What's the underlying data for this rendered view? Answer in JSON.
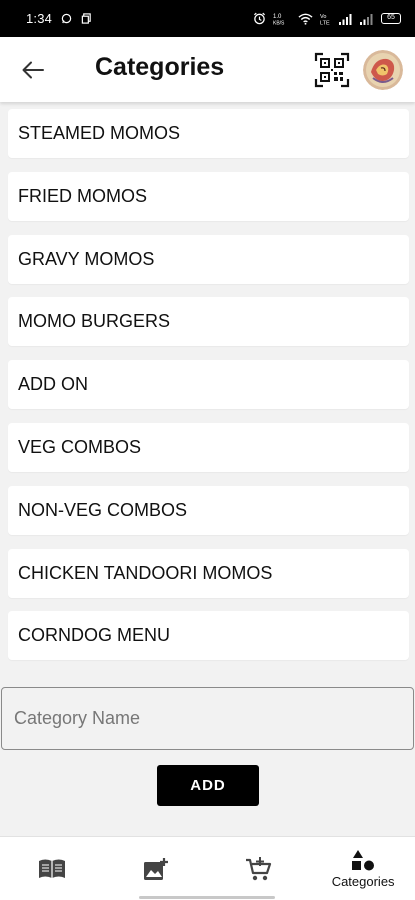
{
  "status_bar": {
    "time": "1:34",
    "battery": "65"
  },
  "header": {
    "title": "Categories"
  },
  "categories": [
    "STEAMED MOMOS",
    "FRIED MOMOS",
    "GRAVY MOMOS",
    "MOMO BURGERS",
    "ADD ON",
    "VEG COMBOS",
    "NON-VEG COMBOS",
    "CHICKEN TANDOORI MOMOS",
    "CORNDOG MENU"
  ],
  "form": {
    "placeholder": "Category Name",
    "value": "",
    "add_label": "ADD"
  },
  "bottom_nav": {
    "items": [
      {
        "icon": "menu-book-icon",
        "label": ""
      },
      {
        "icon": "add-photo-icon",
        "label": ""
      },
      {
        "icon": "add-cart-icon",
        "label": ""
      },
      {
        "icon": "categories-icon",
        "label": "Categories"
      }
    ]
  },
  "colors": {
    "background": "#f2f2f2",
    "surface": "#ffffff",
    "primary": "#000000"
  }
}
